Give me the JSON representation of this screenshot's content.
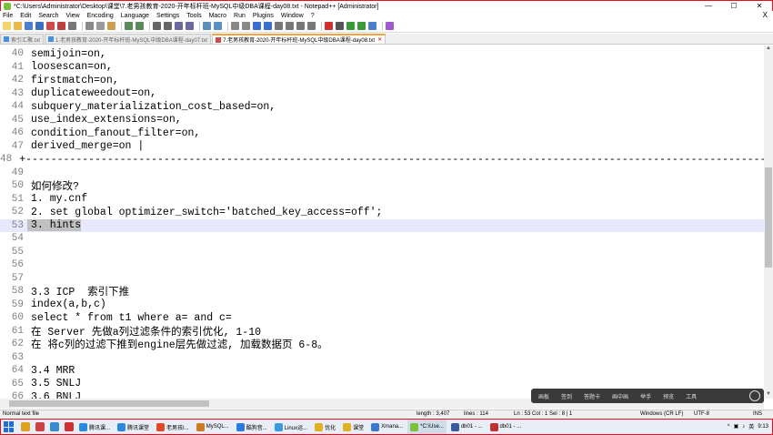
{
  "window": {
    "title": "*C:\\Users\\Administrator\\Desktop\\课堂\\7.老男孩教育-2020-开年标杆班-MySQL中级DBA课程-day08.txt - Notepad++ [Administrator]",
    "minimize": "—",
    "maximize": "☐",
    "close": "✕"
  },
  "menu": {
    "items": [
      "File",
      "Edit",
      "Search",
      "View",
      "Encoding",
      "Language",
      "Settings",
      "Tools",
      "Macro",
      "Run",
      "Plugins",
      "Window",
      "?"
    ],
    "close_doc": "X"
  },
  "tabs": [
    {
      "label": "索引汇聚.txt",
      "active": false
    },
    {
      "label": "1.老男孩教育-2020-开年标杆班-MySQL中级DBA课程-day07.txt",
      "active": false
    },
    {
      "label": "7.老男孩教育-2020-开年标杆班-MySQL中级DBA课程-day08.txt",
      "active": true
    }
  ],
  "editor": {
    "lines": [
      {
        "n": "40",
        "text": "semijoin=on,"
      },
      {
        "n": "41",
        "text": "loosescan=on,"
      },
      {
        "n": "42",
        "text": "firstmatch=on,"
      },
      {
        "n": "43",
        "text": "duplicateweedout=on,"
      },
      {
        "n": "44",
        "text": "subquery_materialization_cost_based=on,"
      },
      {
        "n": "45",
        "text": "use_index_extensions=on,"
      },
      {
        "n": "46",
        "text": "condition_fanout_filter=on,"
      },
      {
        "n": "47",
        "text": "derived_merge=on |"
      },
      {
        "n": "48",
        "text": "+-----------------------------------------------------------------------------------------------------------------------"
      },
      {
        "n": "49",
        "text": ""
      },
      {
        "n": "50",
        "text": "如何修改?"
      },
      {
        "n": "51",
        "text": "1. my.cnf"
      },
      {
        "n": "52",
        "text": "2. set global optimizer_switch='batched_key_access=off';"
      },
      {
        "n": "53",
        "text": "3. hints",
        "current": true
      },
      {
        "n": "54",
        "text": ""
      },
      {
        "n": "55",
        "text": ""
      },
      {
        "n": "56",
        "text": ""
      },
      {
        "n": "57",
        "text": ""
      },
      {
        "n": "58",
        "text": "3.3 ICP  索引下推"
      },
      {
        "n": "59",
        "text": "index(a,b,c)"
      },
      {
        "n": "60",
        "text": "select * from t1 where a= and c="
      },
      {
        "n": "61",
        "text": "在 Server 先做a列过滤条件的索引优化, 1-10"
      },
      {
        "n": "62",
        "text": "在 将c列的过滤下推到engine层先做过滤, 加载数据页 6-8。"
      },
      {
        "n": "63",
        "text": ""
      },
      {
        "n": "64",
        "text": "3.4 MRR"
      },
      {
        "n": "65",
        "text": "3.5 SNLJ"
      },
      {
        "n": "66",
        "text": "3.6 BNLJ"
      }
    ]
  },
  "overlay": {
    "buttons": [
      "画板",
      "签到",
      "答题卡",
      "画中画",
      "举手",
      "预览",
      "工具"
    ]
  },
  "status": {
    "type": "Normal text file",
    "length": "length : 3,407",
    "lines": "lines : 114",
    "position": "Ln : 53   Col : 1   Sel : 8 | 1",
    "eol": "Windows (CR LF)",
    "encoding": "UTF-8",
    "mode": "INS"
  },
  "taskbar": {
    "apps": [
      "腾讯课...",
      "腾讯课堂",
      "老男孩I...",
      "MySQL...",
      "酷狗音...",
      "Linux运...",
      "优化",
      "课堂",
      "Xmana...",
      "*C:\\Use...",
      "db01 - ...",
      "db01 - ..."
    ],
    "clock": "9:13",
    "lang": "英"
  },
  "colors": {
    "accent": "#f7a23b",
    "current_line": "#e8e8ff",
    "selection": "#c0c0c0"
  }
}
